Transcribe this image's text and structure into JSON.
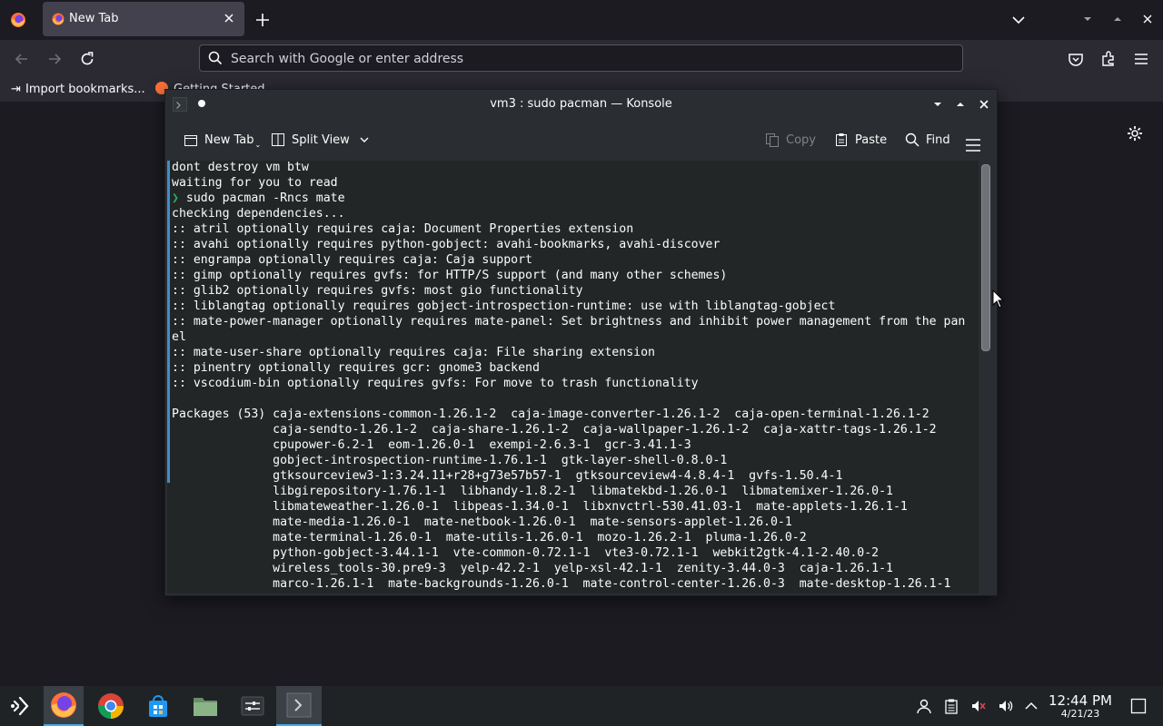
{
  "browser": {
    "tab": {
      "title": "New Tab"
    },
    "urlbar": {
      "placeholder": "Search with Google or enter address"
    },
    "bookmarks": [
      {
        "label": "Import bookmarks..."
      },
      {
        "label": "Getting Started"
      }
    ]
  },
  "konsole": {
    "title": "vm3 : sudo pacman — Konsole",
    "toolbar": {
      "new_tab": "New Tab",
      "split_view": "Split View",
      "copy": "Copy",
      "paste": "Paste",
      "find": "Find"
    },
    "terminal": {
      "lines_before_prompt": "dont destroy vm btw\nwaiting for you to read",
      "prompt_symbol": "❯",
      "command": " sudo pacman -Rncs mate",
      "output": "checking dependencies...\n:: atril optionally requires caja: Document Properties extension\n:: avahi optionally requires python-gobject: avahi-bookmarks, avahi-discover\n:: engrampa optionally requires caja: Caja support\n:: gimp optionally requires gvfs: for HTTP/S support (and many other schemes)\n:: glib2 optionally requires gvfs: most gio functionality\n:: liblangtag optionally requires gobject-introspection-runtime: use with liblangtag-gobject\n:: mate-power-manager optionally requires mate-panel: Set brightness and inhibit power management from the pan\nel\n:: mate-user-share optionally requires caja: File sharing extension\n:: pinentry optionally requires gcr: gnome3 backend\n:: vscodium-bin optionally requires gvfs: For move to trash functionality\n\nPackages (53) caja-extensions-common-1.26.1-2  caja-image-converter-1.26.1-2  caja-open-terminal-1.26.1-2\n              caja-sendto-1.26.1-2  caja-share-1.26.1-2  caja-wallpaper-1.26.1-2  caja-xattr-tags-1.26.1-2\n              cpupower-6.2-1  eom-1.26.0-1  exempi-2.6.3-1  gcr-3.41.1-3\n              gobject-introspection-runtime-1.76.1-1  gtk-layer-shell-0.8.0-1\n              gtksourceview3-1:3.24.11+r28+g73e57b57-1  gtksourceview4-4.8.4-1  gvfs-1.50.4-1\n              libgirepository-1.76.1-1  libhandy-1.8.2-1  libmatekbd-1.26.0-1  libmatemixer-1.26.0-1\n              libmateweather-1.26.0-1  libpeas-1.34.0-1  libxnvctrl-530.41.03-1  mate-applets-1.26.1-1\n              mate-media-1.26.0-1  mate-netbook-1.26.0-1  mate-sensors-applet-1.26.0-1\n              mate-terminal-1.26.0-1  mate-utils-1.26.0-1  mozo-1.26.2-1  pluma-1.26.0-2\n              python-gobject-3.44.1-1  vte-common-0.72.1-1  vte3-0.72.1-1  webkit2gtk-4.1-2.40.0-2\n              wireless_tools-30.pre9-3  yelp-42.2-1  yelp-xsl-42.1-1  zenity-3.44.0-3  caja-1.26.1-1\n              marco-1.26.1-1  mate-backgrounds-1.26.0-1  mate-control-center-1.26.0-3  mate-desktop-1.26.1-1"
    }
  },
  "taskbar": {
    "clock_time": "12:44 PM",
    "clock_date": "4/21/23"
  },
  "colors": {
    "firefox_bg": "#1c1b22",
    "firefox_toolbar": "#2b2a33",
    "konsole_bg": "#2a2e32",
    "terminal_bg": "#232627",
    "prompt_green": "#27ae60",
    "taskbar_bg": "#202326",
    "accent": "#3daee9"
  },
  "icons": [
    "firefox-icon",
    "close-icon",
    "plus-icon",
    "chevron-down-icon",
    "back-arrow-icon",
    "forward-arrow-icon",
    "reload-icon",
    "search-icon",
    "pocket-icon",
    "extensions-icon",
    "hamburger-menu-icon",
    "gear-icon",
    "new-tab-icon",
    "split-view-icon",
    "copy-icon",
    "paste-icon",
    "find-icon",
    "application-launcher-icon",
    "chrome-icon",
    "store-icon",
    "folder-icon",
    "settings-icon",
    "konsole-icon",
    "user-icon",
    "clipboard-icon",
    "mute-icon",
    "volume-icon",
    "chevron-up-icon",
    "show-desktop-icon"
  ]
}
